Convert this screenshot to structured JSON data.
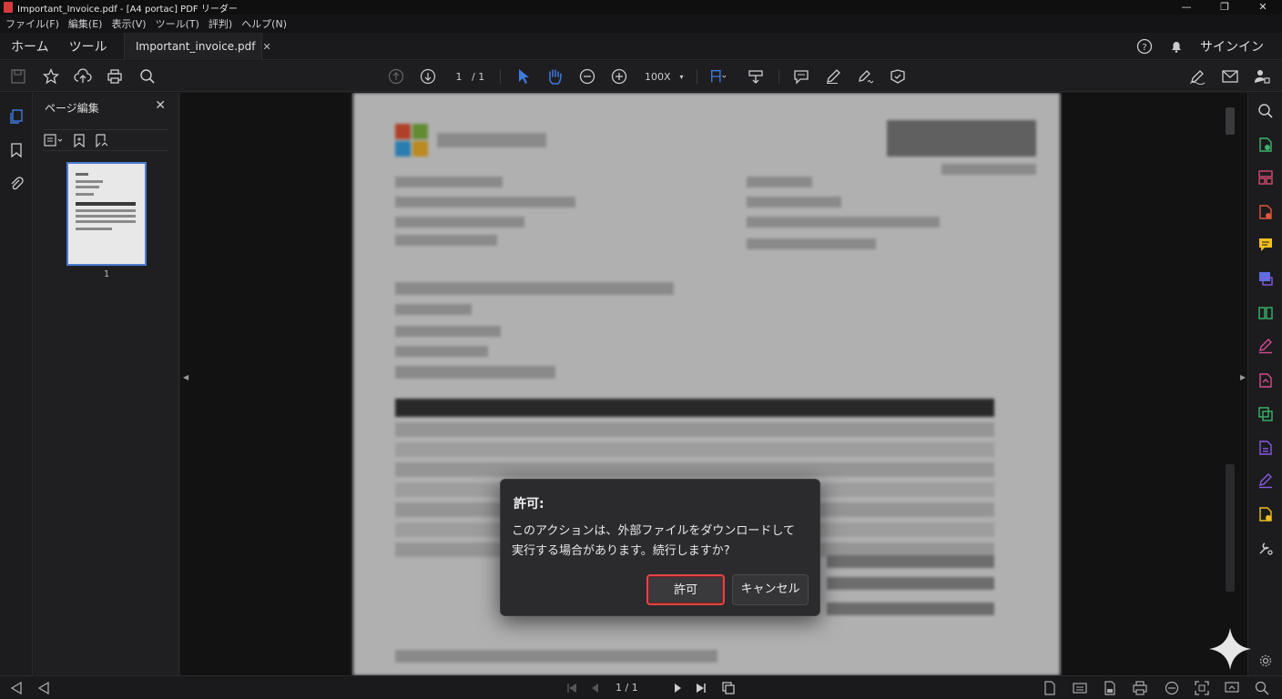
{
  "window": {
    "title": "Important_Invoice.pdf - [A4 portac] PDF リーダー",
    "controls": [
      "—",
      "❐",
      "✕"
    ]
  },
  "menu": [
    "ファイル(F)",
    "編集(E)",
    "表示(V)",
    "ツール(T)",
    "評判)",
    "ヘルプ(N)"
  ],
  "tabs": {
    "home": "ホーム",
    "tools": "ツール",
    "document": "Important_invoice.pdf",
    "signin": "サインイン"
  },
  "toolbar": {
    "page_current": "1",
    "page_total": "/ 1",
    "zoom": "100X"
  },
  "side_panel": {
    "title": "ページ編集",
    "thumbnail_label": "1"
  },
  "statusbar": {
    "page": "1 / 1"
  },
  "dialog": {
    "title": "許可:",
    "message": "このアクションは、外部ファイルをダウンロードして実行する場合があります。続行しますか?",
    "allow_label": "許可",
    "cancel_label": "キャンセル"
  },
  "colors": {
    "accent_blue": "#3d7be0",
    "allow_border": "#e04545"
  }
}
